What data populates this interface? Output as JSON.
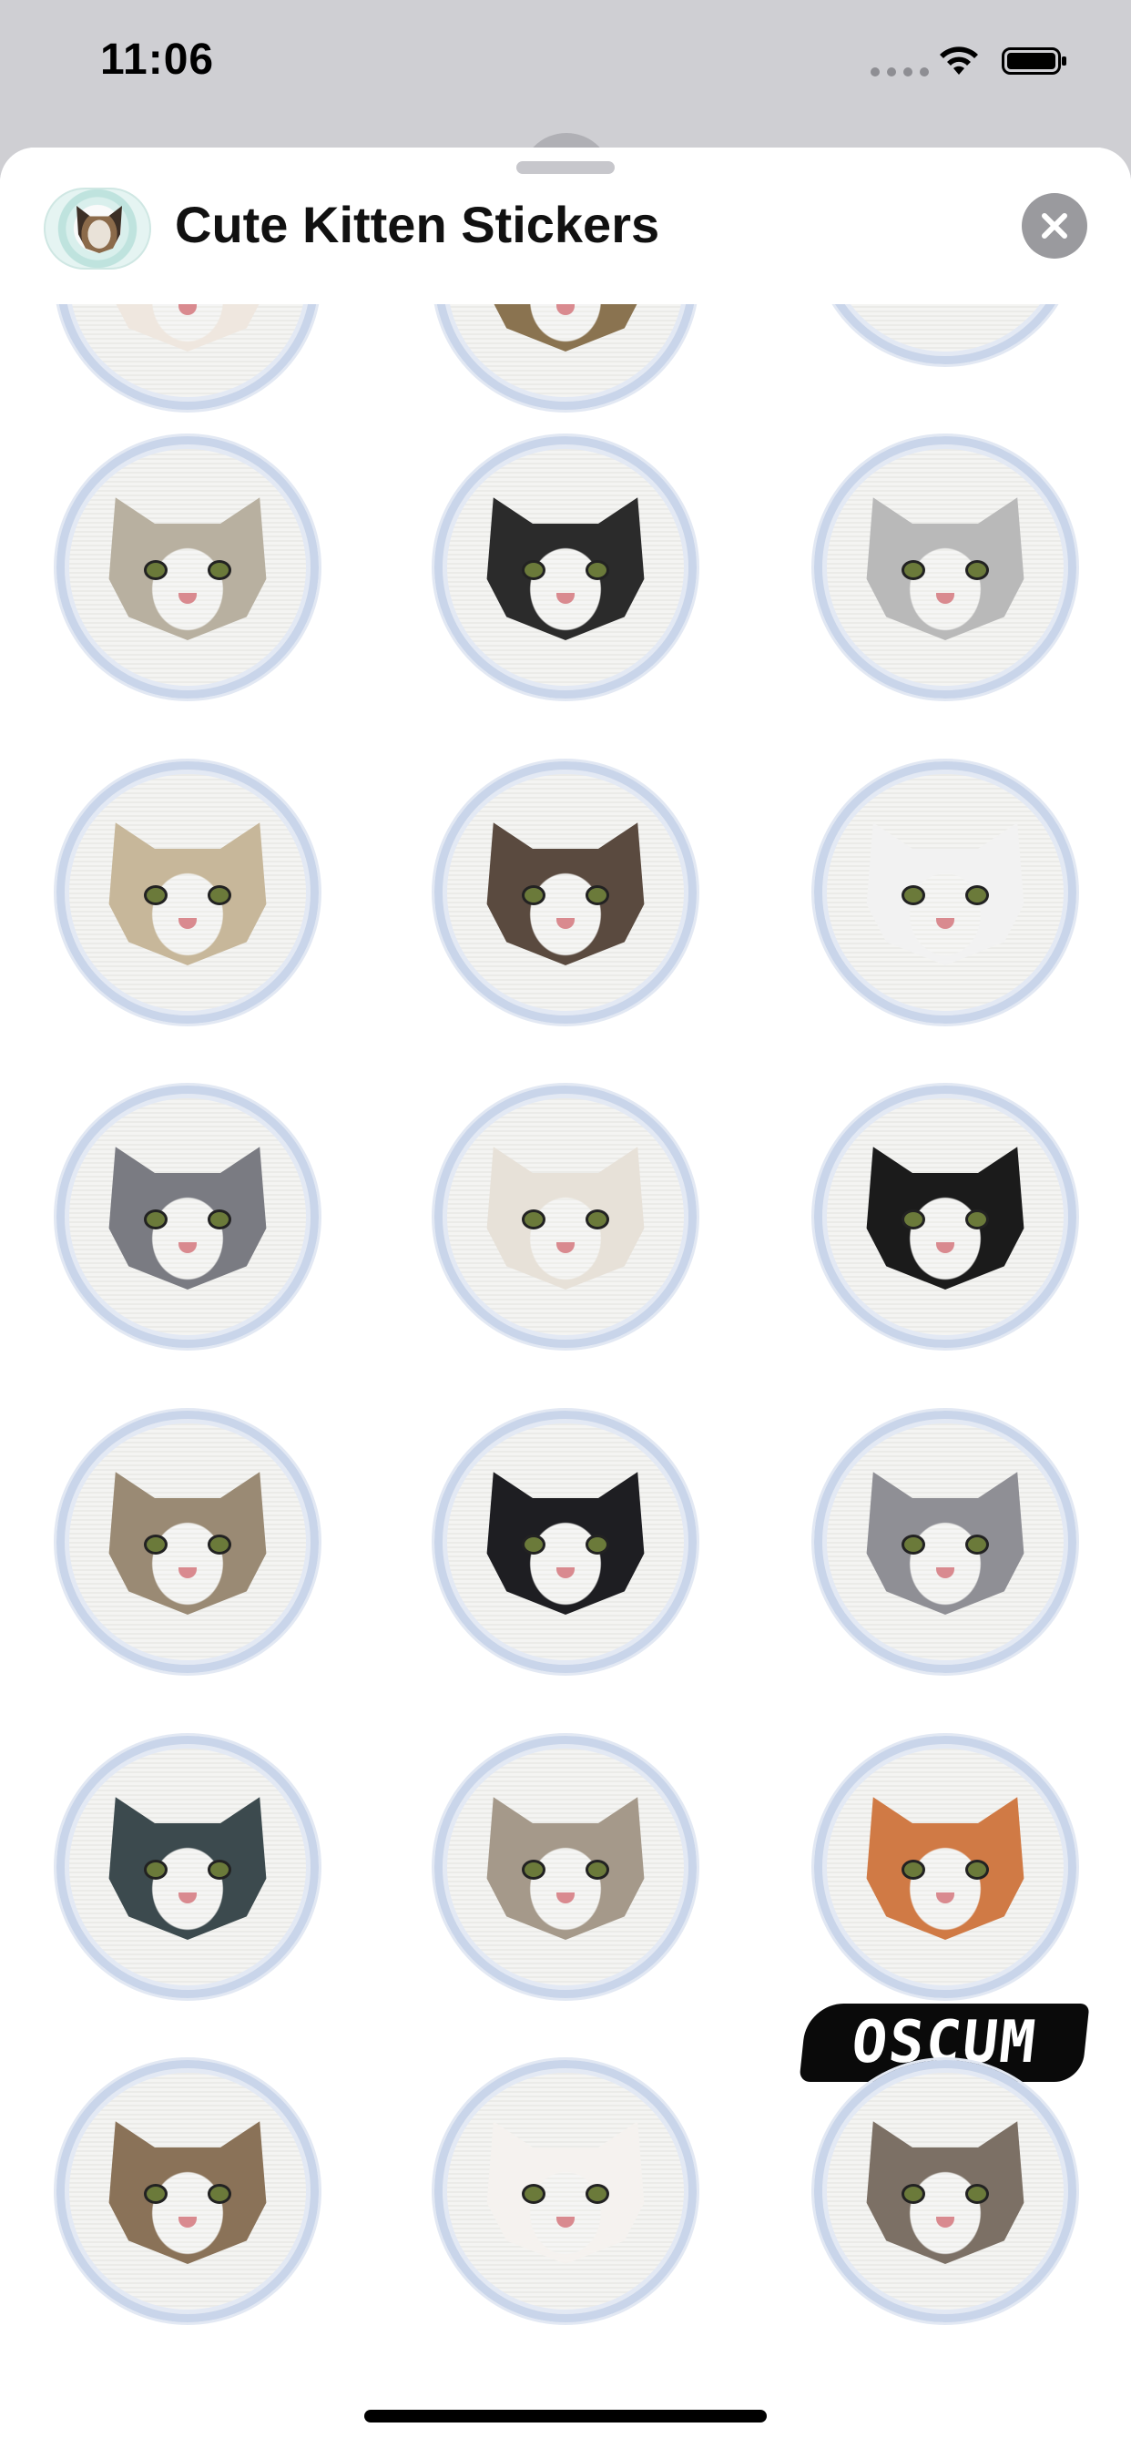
{
  "status_bar": {
    "time": "11:06"
  },
  "sheet": {
    "title": "Cute Kitten Stickers"
  },
  "colors": {
    "ring": "#c9d5ea",
    "sheet_bg": "#ffffff",
    "backdrop": "#cfcfd3",
    "close": "#9a9a9e"
  },
  "icons": {
    "wifi": "wifi-icon",
    "battery": "battery-icon",
    "close": "close-icon"
  },
  "stickers": [
    {
      "id": "sticker-1",
      "fur": "#b8b0a0"
    },
    {
      "id": "sticker-2",
      "fur": "#2b2b2b"
    },
    {
      "id": "sticker-3",
      "fur": "#b9b9b9"
    },
    {
      "id": "sticker-4",
      "fur": "#c7b79a"
    },
    {
      "id": "sticker-5",
      "fur": "#5a4a3f"
    },
    {
      "id": "sticker-6",
      "fur": "#f2f2f2"
    },
    {
      "id": "sticker-7",
      "fur": "#7a7b82"
    },
    {
      "id": "sticker-8",
      "fur": "#e7e1d8"
    },
    {
      "id": "sticker-9",
      "fur": "#1b1b1b"
    },
    {
      "id": "sticker-10",
      "fur": "#9a8a74"
    },
    {
      "id": "sticker-11",
      "fur": "#1e1e22"
    },
    {
      "id": "sticker-12",
      "fur": "#8f8f95"
    },
    {
      "id": "sticker-13",
      "fur": "#3c4a4e"
    },
    {
      "id": "sticker-14",
      "fur": "#a5998a"
    },
    {
      "id": "sticker-15",
      "fur": "#d07a45"
    },
    {
      "id": "sticker-16",
      "fur": "#8a7258"
    },
    {
      "id": "sticker-17",
      "fur": "#f5f2ef"
    },
    {
      "id": "sticker-18",
      "fur": "#7c7065"
    },
    {
      "id": "sticker-19",
      "fur": "#efe7df"
    },
    {
      "id": "sticker-20",
      "fur": "#8a7350"
    }
  ],
  "footer_logo": "OSCUM"
}
